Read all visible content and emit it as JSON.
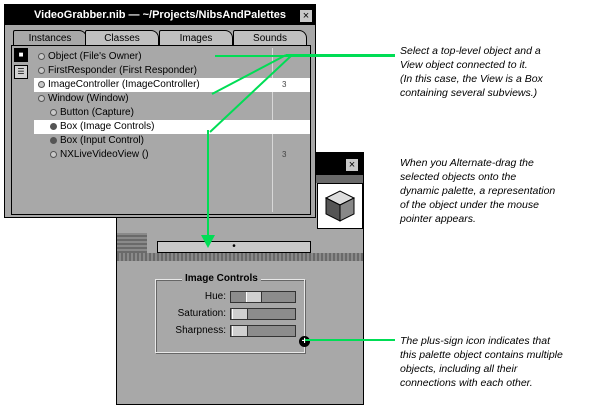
{
  "inspector": {
    "title": "VideoGrabber.nib — ~/Projects/NibsAndPalettes",
    "close_glyph": "×",
    "tabs": [
      "Instances",
      "Classes",
      "Images",
      "Sounds"
    ],
    "active_tab": "Instances",
    "mode_icons": [
      "icon-view-icon",
      "outline-view-icon"
    ],
    "objects": [
      {
        "name": "Object (File's Owner)",
        "indent": 0,
        "dot": "light",
        "connections": ""
      },
      {
        "name": "FirstResponder (First Responder)",
        "indent": 0,
        "dot": "light",
        "connections": ""
      },
      {
        "name": "ImageController (ImageController)",
        "indent": 0,
        "dot": "light",
        "connections": "3",
        "selected": true
      },
      {
        "name": "Window (Window)",
        "indent": 0,
        "dot": "light",
        "connections": ""
      },
      {
        "name": "Button (Capture)",
        "indent": 1,
        "dot": "light",
        "connections": ""
      },
      {
        "name": "Box (Image Controls)",
        "indent": 1,
        "dot": "dark",
        "connections": "",
        "selected": true
      },
      {
        "name": "Box (Input Control)",
        "indent": 1,
        "dot": "dark",
        "connections": ""
      },
      {
        "name": "NXLiveVideoView ()",
        "indent": 1,
        "dot": "light",
        "connections": "3"
      }
    ]
  },
  "palette": {
    "close_glyph": "×",
    "box_title": "Image Controls",
    "sliders": [
      {
        "label": "Hue:",
        "value": 0.3
      },
      {
        "label": "Saturation:",
        "value": 0.02
      },
      {
        "label": "Sharpness:",
        "value": 0.02
      }
    ],
    "plus_glyph": "+",
    "cube_icon": "cube-icon"
  },
  "annotations": {
    "a1": [
      "Select a top-level object and a",
      "View object connected to it.",
      "(In this case, the View is a Box",
      "containing several subviews.)"
    ],
    "a2": [
      "When you Alternate-drag the",
      "selected objects onto the",
      "dynamic palette, a representation",
      "of the object under the mouse",
      "pointer appears."
    ],
    "a3": [
      "The plus-sign icon indicates that",
      "this palette object contains multiple",
      "objects, including all their",
      "connections with each other."
    ]
  },
  "colors": {
    "highlight": "#00dd55",
    "window_gray": "#a8a8a8",
    "title_black": "#000000"
  }
}
